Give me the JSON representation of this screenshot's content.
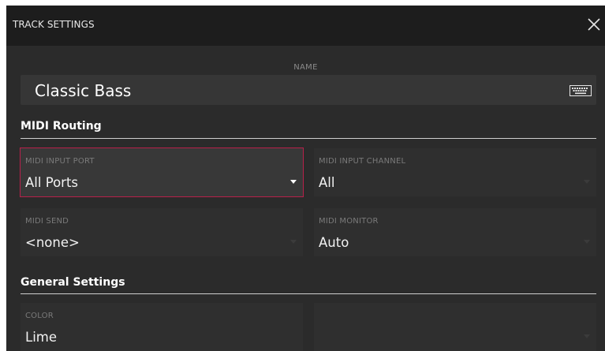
{
  "window": {
    "title": "TRACK SETTINGS"
  },
  "name": {
    "label": "NAME",
    "value": "Classic Bass"
  },
  "sections": {
    "midi_routing": "MIDI Routing",
    "general_settings": "General Settings"
  },
  "fields": {
    "midi_input_port": {
      "label": "MIDI INPUT PORT",
      "value": "All Ports"
    },
    "midi_input_channel": {
      "label": "MIDI INPUT CHANNEL",
      "value": "All"
    },
    "midi_send": {
      "label": "MIDI SEND",
      "value": "<none>"
    },
    "midi_monitor": {
      "label": "MIDI MONITOR",
      "value": "Auto"
    },
    "color": {
      "label": "COLOR",
      "value": "Lime"
    }
  },
  "colors": {
    "focus_accent": "#b8204a",
    "panel_bg": "#2b2b2b",
    "titlebar_bg": "#1d1d1d"
  },
  "icons": {
    "close": "close-icon",
    "keyboard": "keyboard-icon",
    "dropdown": "chevron-down-icon"
  }
}
